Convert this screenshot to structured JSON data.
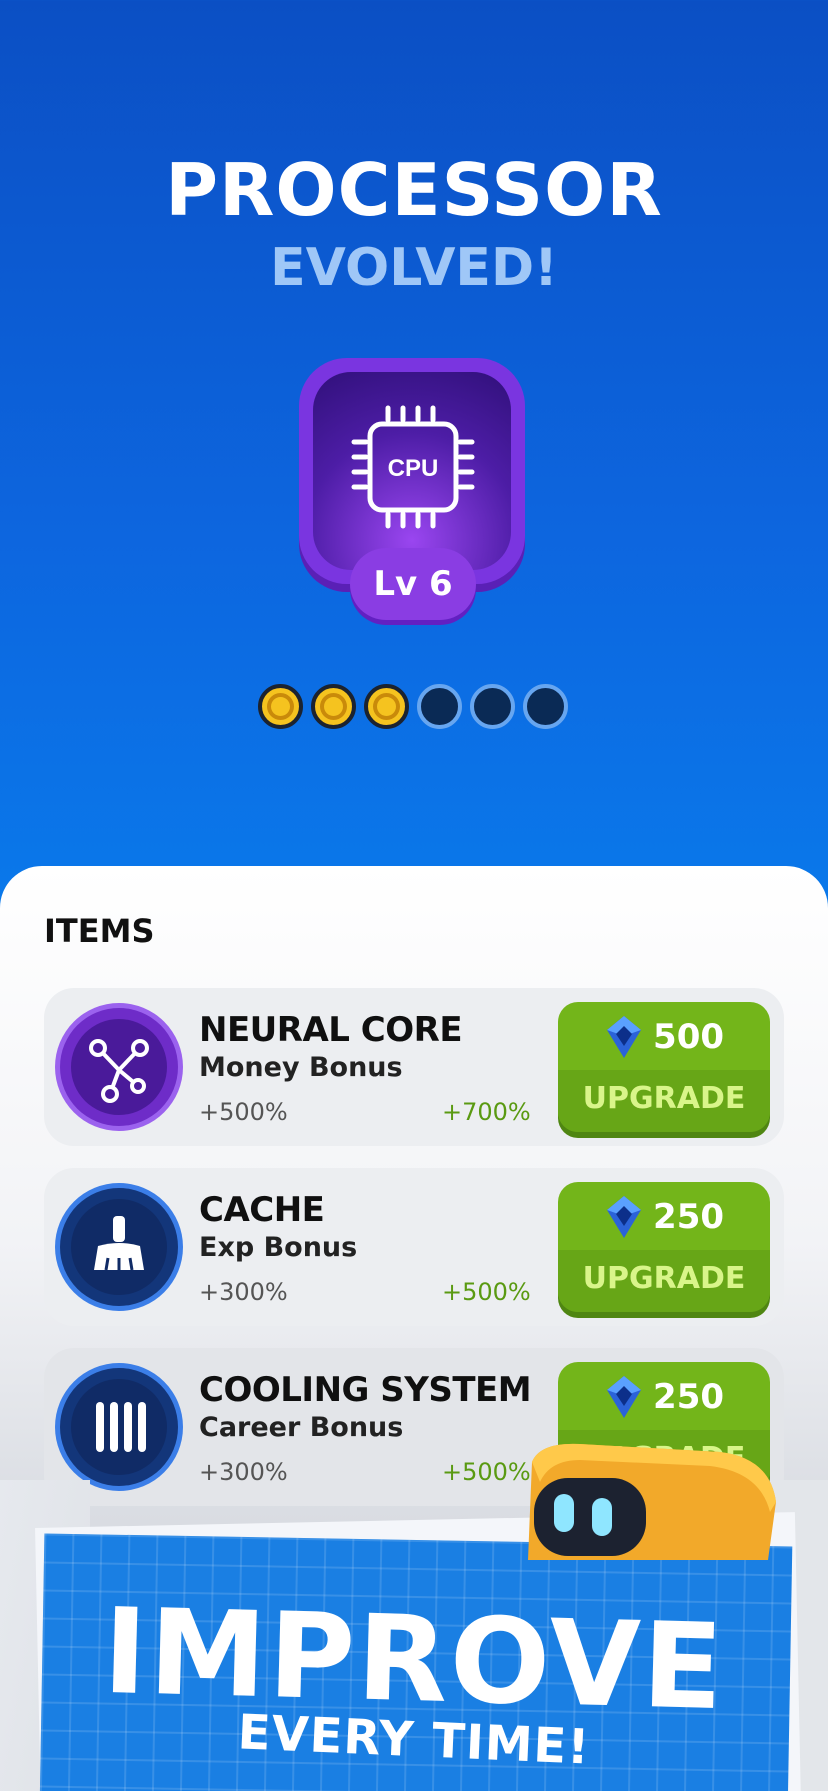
{
  "header": {
    "title": "PROCESSOR",
    "subtitle": "EVOLVED!"
  },
  "module": {
    "icon": "cpu-icon",
    "icon_text": "CPU",
    "level_label": "Lv 6",
    "progress": {
      "filled": 3,
      "total": 6
    }
  },
  "items_section": {
    "label": "ITEMS",
    "items": [
      {
        "name": "NEURAL CORE",
        "bonus": "Money Bonus",
        "current": "+500%",
        "next": "+700%",
        "price": "500",
        "button": "UPGRADE",
        "icon": "network-icon"
      },
      {
        "name": "CACHE",
        "bonus": "Exp Bonus",
        "current": "+300%",
        "next": "+500%",
        "price": "250",
        "button": "UPGRADE",
        "icon": "broom-icon"
      },
      {
        "name": "COOLING SYSTEM",
        "bonus": "Career Bonus",
        "current": "+300%",
        "next": "+500%",
        "price": "250",
        "button": "UPGRADE",
        "icon": "radiator-icon"
      }
    ]
  },
  "promo": {
    "title": "IMPROVE",
    "subtitle": "EVERY TIME!"
  },
  "colors": {
    "background_top": "#0b4fc4",
    "background_bottom": "#0a82ee",
    "module_purple": "#7a35e0",
    "upgrade_green": "#73b51a",
    "coin_gold": "#f5c31f",
    "gain_green": "#5a9a12"
  }
}
